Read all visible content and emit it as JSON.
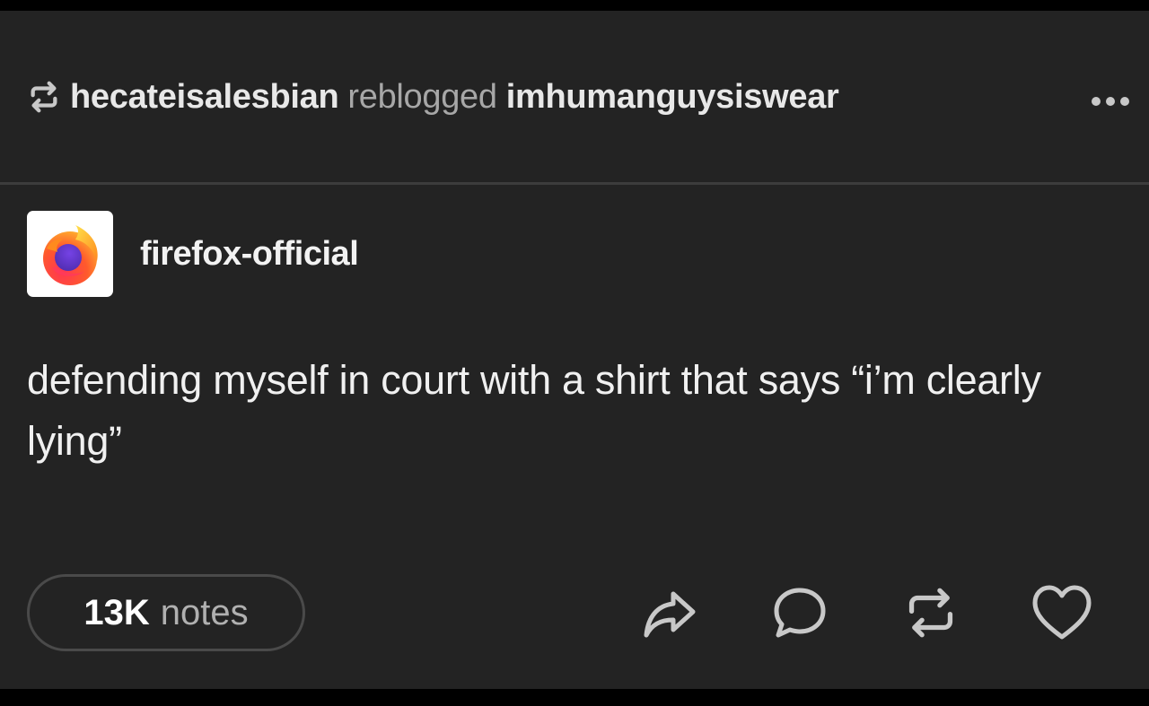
{
  "header": {
    "reblogger": "hecateisalesbian",
    "verb": "reblogged",
    "source": "imhumanguysiswear",
    "reblog_icon": "reblog-icon",
    "more_icon": "more-horizontal-icon"
  },
  "post": {
    "author": "firefox-official",
    "avatar_icon": "firefox-logo",
    "body": "defending myself in court with a shirt that says “i’m clearly lying”"
  },
  "footer": {
    "notes_count": "13K",
    "notes_label": "notes",
    "actions": [
      "share-icon",
      "reply-icon",
      "reblog-icon",
      "like-icon"
    ]
  },
  "colors": {
    "background": "#232323",
    "text": "#ffffff",
    "muted": "#a7a7a7",
    "divider": "#3c3c3c"
  }
}
